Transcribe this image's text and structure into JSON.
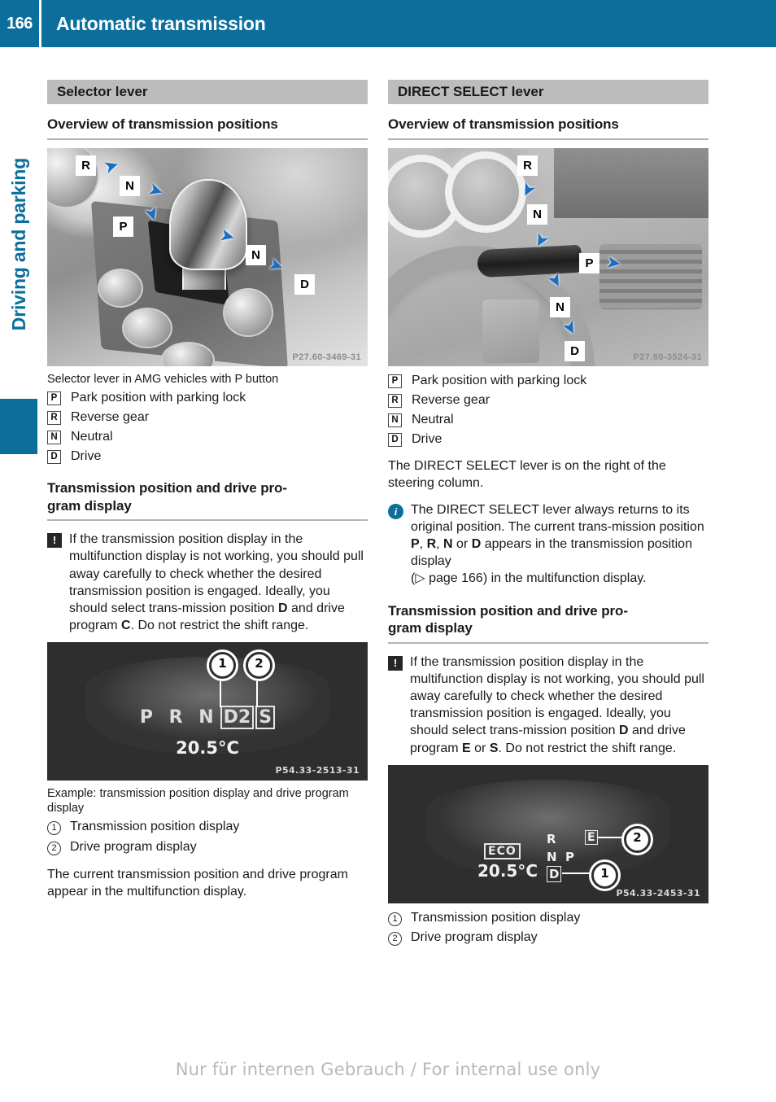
{
  "header": {
    "page_number": "166",
    "title": "Automatic transmission"
  },
  "side_tab": {
    "label": "Driving and parking"
  },
  "footer": {
    "text": "Nur für internen Gebrauch / For internal use only"
  },
  "left_column": {
    "section_bar": "Selector lever",
    "heading_overview": "Overview of transmission positions",
    "photo_code": "P27.60-3469-31",
    "photo_callouts": [
      "R",
      "N",
      "P",
      "N",
      "D"
    ],
    "photo_caption": "Selector lever in AMG vehicles with P button",
    "gear_list": [
      {
        "letter": "P",
        "label": "Park position with parking lock"
      },
      {
        "letter": "R",
        "label": "Reverse gear"
      },
      {
        "letter": "N",
        "label": "Neutral"
      },
      {
        "letter": "D",
        "label": "Drive"
      }
    ],
    "heading_display": "Transmission position and drive pro-\ngram display",
    "warning": {
      "icon": "warning-icon",
      "text_part1": "If the transmission position display in the multifunction display is not working, you should pull away carefully to check whether the desired transmission position is engaged. Ideally, you should select trans-mission position ",
      "bold1": "D",
      "text_part2": " and drive program ",
      "bold2": "C",
      "text_part3": ". Do not restrict the shift range."
    },
    "display_image": {
      "gears": "P R N",
      "boxed_gear": "D2",
      "boxed_program": "S",
      "temperature": "20.5°C",
      "code": "P54.33-2513-31",
      "markers": [
        "1",
        "2"
      ]
    },
    "display_caption": "Example: transmission position display and drive program display",
    "numbered_list": [
      {
        "num": "1",
        "label": "Transmission position display"
      },
      {
        "num": "2",
        "label": "Drive program display"
      }
    ],
    "closing_paragraph": "The current transmission position and drive program appear in the multifunction display."
  },
  "right_column": {
    "section_bar": "DIRECT SELECT lever",
    "heading_overview": "Overview of transmission positions",
    "photo_code": "P27.60-3524-31",
    "photo_callouts": [
      "R",
      "N",
      "P",
      "N",
      "D"
    ],
    "gear_list": [
      {
        "letter": "P",
        "label": "Park position with parking lock"
      },
      {
        "letter": "R",
        "label": "Reverse gear"
      },
      {
        "letter": "N",
        "label": "Neutral"
      },
      {
        "letter": "D",
        "label": "Drive"
      }
    ],
    "lever_location": "The DIRECT SELECT lever is on the right of the steering column.",
    "info": {
      "icon": "info-icon",
      "text_part1": "The DIRECT SELECT lever always returns to its original position. The current trans-mission position ",
      "bold_p": "P",
      "sep1": ", ",
      "bold_r": "R",
      "sep2": ", ",
      "bold_n": "N",
      "sep3": " or ",
      "bold_d": "D",
      "text_part2": " appears in the transmission position display",
      "page_ref_prefix": "(",
      "page_ref_arrow": "▷",
      "page_ref": " page 166",
      "page_ref_suffix": ") in the multifunction display."
    },
    "heading_display": "Transmission position and drive pro-\ngram display",
    "warning": {
      "icon": "warning-icon",
      "text_part1": "If the transmission position display in the multifunction display is not working, you should pull away carefully to check whether the desired transmission position is engaged. Ideally, you should select trans-mission position ",
      "bold1": "D",
      "text_part2": " and drive program ",
      "bold2": "E",
      "text_part3": " or ",
      "bold3": "S",
      "text_part4": ". Do not restrict the shift range."
    },
    "display_image": {
      "eco_badge": "ECO",
      "temperature": "20.5°C",
      "positions": [
        "R",
        "N",
        "P",
        "D"
      ],
      "program": "E",
      "code": "P54.33-2453-31",
      "markers": [
        "1",
        "2"
      ]
    },
    "numbered_list": [
      {
        "num": "1",
        "label": "Transmission position display"
      },
      {
        "num": "2",
        "label": "Drive program display"
      }
    ]
  },
  "colors": {
    "brand_blue": "#0c6e9c",
    "section_gray": "#bcbcbc",
    "callout_blue": "#1a6fc4"
  }
}
